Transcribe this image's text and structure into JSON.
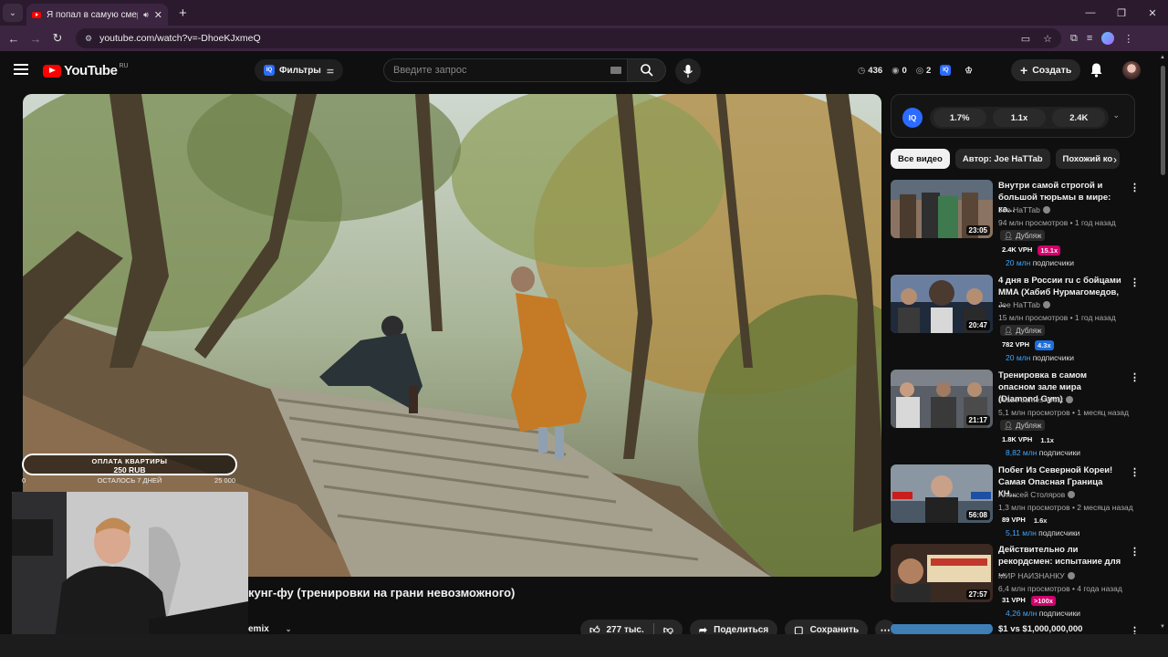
{
  "browser": {
    "tab_title": "Я попал в самую смертон",
    "url": "youtube.com/watch?v=-DhoeKJxmeQ",
    "new_tab": "+",
    "window_controls": [
      "—",
      "❐",
      "✕"
    ]
  },
  "header": {
    "logo_text": "YouTube",
    "logo_region": "RU",
    "filters_label": "Фильтры",
    "search_placeholder": "Введите запрос",
    "stat1": "436",
    "stat2": "0",
    "stat3": "2",
    "create_label": "Создать"
  },
  "overlay": {
    "rent_title": "ОПЛАТА КВАРТИРЫ",
    "rent_amount": "250 RUB",
    "rent_min": "0",
    "rent_left": "ОСТАЛОСЬ 7 ДНЕЙ",
    "rent_max": "25 000"
  },
  "video": {
    "title_fragment": "кунг-фу (тренировки на грани невозможного)",
    "channel_fragment": "emix",
    "likes": "277 тыс.",
    "share_label": "Поделиться",
    "save_label": "Сохранить"
  },
  "sidebar": {
    "metrics": {
      "iq": "IQ",
      "m1": "1.7%",
      "m2": "1.1x",
      "m3": "2.4K"
    },
    "chips": [
      "Все видео",
      "Автор: Joe HaTTab",
      "Похожий ко"
    ],
    "recs": [
      {
        "title": "Внутри самой строгой и большой тюрьмы в мире: ка...",
        "channel": "Joe HaTTab",
        "meta": "94 млн просмотров • 1 год назад",
        "dub": "Дубляж",
        "vph": "2.4K VPH",
        "badge": "15.1x",
        "badge_color": "#d1006b",
        "subs_n": "20 млн",
        "subs_label": "подписчики",
        "duration": "23:05"
      },
      {
        "title": "4 дня в России ru с бойцами MMA (Хабиб Нурмагомедов, ...",
        "channel": "Joe HaTTab",
        "meta": "15 млн просмотров • 1 год назад",
        "dub": "Дубляж",
        "vph": "782 VPH",
        "badge": "4.3x",
        "badge_color": "#1b6fe0",
        "subs_n": "20 млн",
        "subs_label": "подписчики",
        "duration": "20:47"
      },
      {
        "title": "Тренировка в самом опасном зале мира (Diamond Gym)",
        "channel": "Jesse James West",
        "meta": "5,1 млн просмотров • 1 месяц назад",
        "dub": "Дубляж",
        "vph": "1.8K VPH",
        "badge": "1.1x",
        "badge_color": "transparent",
        "subs_n": "8,82 млн",
        "subs_label": "подписчики",
        "duration": "21:17"
      },
      {
        "title": "Побег Из Северной Кореи! Самая Опасная Граница КН...",
        "channel": "Алексей Столяров",
        "meta": "1,3 млн просмотров • 2 месяца назад",
        "dub": "",
        "vph": "89 VPH",
        "badge": "1.6x",
        "badge_color": "transparent",
        "subs_n": "5,11 млн",
        "subs_label": "подписчики",
        "duration": "56:08"
      },
      {
        "title": "Действительно ли рекордсмен: испытание для ...",
        "channel": "МИР НАИЗНАНКУ",
        "meta": "6,4 млн просмотров • 4 года назад",
        "dub": "",
        "vph": "31 VPH",
        "badge": ">100x",
        "badge_color": "#d1006b",
        "subs_n": "4,26 млн",
        "subs_label": "подписчики",
        "duration": "27:57"
      },
      {
        "title": "$1 vs $1,000,000,000",
        "channel": "",
        "meta": "",
        "dub": "",
        "vph": "",
        "badge": "",
        "badge_color": "transparent",
        "subs_n": "",
        "subs_label": "",
        "duration": ""
      }
    ]
  }
}
